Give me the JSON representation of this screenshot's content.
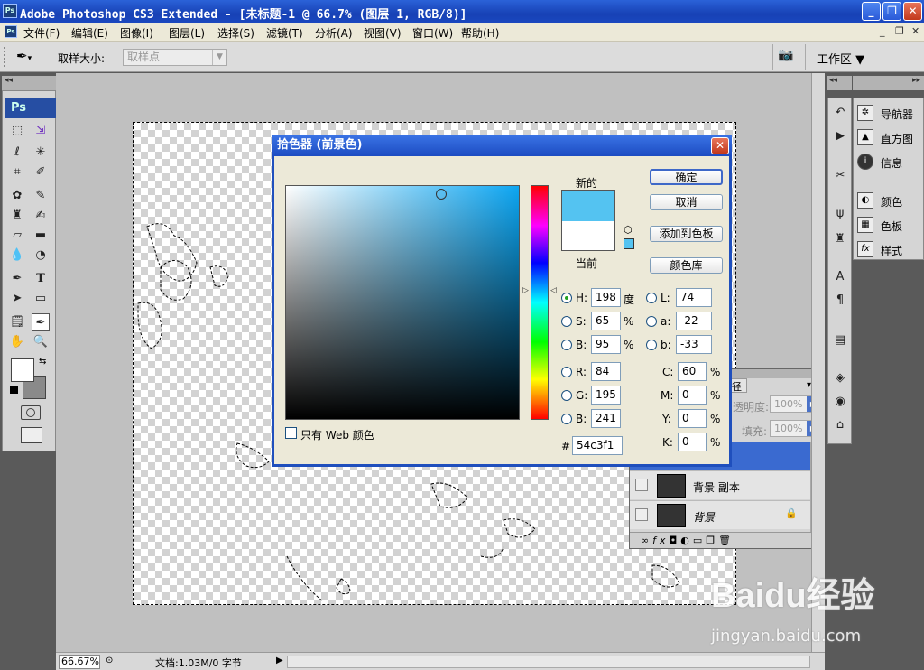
{
  "window": {
    "title": "Adobe Photoshop CS3 Extended - [未标题-1 @ 66.7% (图层 1, RGB/8)]",
    "app_icon": "Ps"
  },
  "menu": [
    "文件(F)",
    "编辑(E)",
    "图像(I)",
    "图层(L)",
    "选择(S)",
    "滤镜(T)",
    "分析(A)",
    "视图(V)",
    "窗口(W)",
    "帮助(H)"
  ],
  "options_bar": {
    "sample_size_label": "取样大小:",
    "sample_value": "取样点",
    "workspace_label": "工作区 ▼"
  },
  "toolbox": {
    "logo": "Ps"
  },
  "right_panel": {
    "items": [
      "导航器",
      "直方图",
      "信息",
      "颜色",
      "色板",
      "样式"
    ]
  },
  "layers_panel": {
    "tab_fragment": "径",
    "opacity_label": "透明度:",
    "opacity_value": "100%",
    "fill_label": "填充:",
    "fill_value": "100%",
    "layers": [
      {
        "name": "背景 副本"
      },
      {
        "name": "背景"
      }
    ]
  },
  "color_picker": {
    "title": "拾色器 (前景色)",
    "new_label": "新的",
    "current_label": "当前",
    "ok": "确定",
    "cancel": "取消",
    "add_to_swatches": "添加到色板",
    "color_libraries": "颜色库",
    "hsb": {
      "H": "198",
      "S": "65",
      "B": "95"
    },
    "hsb_units": {
      "H": "度",
      "S": "%",
      "B": "%"
    },
    "rgb": {
      "R": "84",
      "G": "195",
      "B": "241"
    },
    "lab": {
      "L": "74",
      "a": "-22",
      "b": "-33"
    },
    "cmyk": {
      "C": "60",
      "M": "0",
      "Y": "0",
      "K": "0"
    },
    "hex": "54c3f1",
    "only_web_label": "只有 Web 颜色",
    "selected_radio": "H",
    "new_color": "#54c3f1",
    "current_color": "#ffffff"
  },
  "status_bar": {
    "zoom": "66.67%",
    "doc_info": "文档:1.03M/0 字节"
  },
  "watermark": {
    "text": "Baidu经验",
    "url": "jingyan.baidu.com"
  }
}
